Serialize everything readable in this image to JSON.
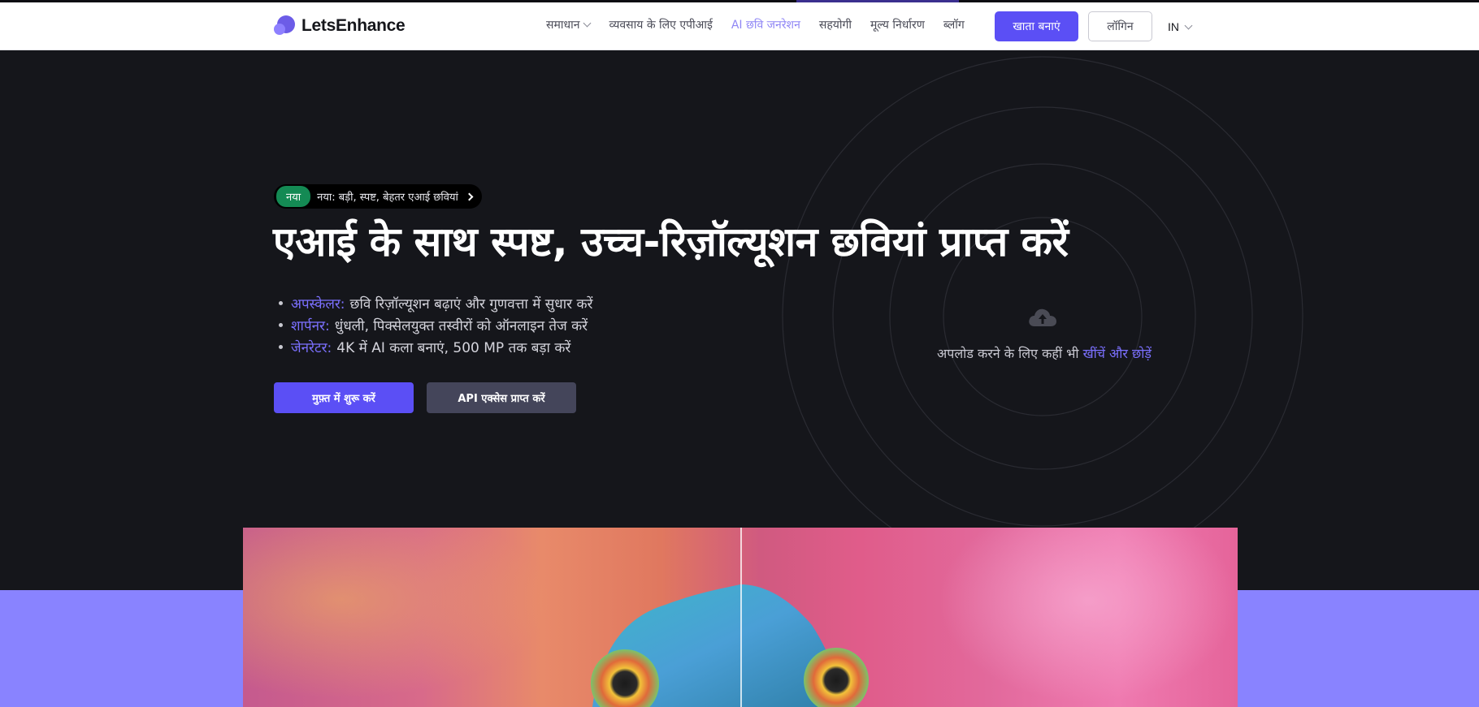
{
  "app": {
    "brand": "LetsEnhance"
  },
  "nav": {
    "items": [
      {
        "label": "समाधान",
        "has_dropdown": true
      },
      {
        "label": "व्यवसाय के लिए एपीआई"
      },
      {
        "label": "AI छवि जनरेशन",
        "active": true
      },
      {
        "label": "सहयोगी"
      },
      {
        "label": "मूल्य निर्धारण"
      },
      {
        "label": "ब्लॉग"
      }
    ],
    "signup_label": "खाता बनाएं",
    "login_label": "लॉगिन",
    "language": "IN"
  },
  "hero": {
    "badge_tag": "नया",
    "badge_text": "नया: बड़ी, स्पष्ट, बेहतर एआई छवियां",
    "headline": "एआई के साथ स्पष्ट, उच्च-रिज़ॉल्यूशन छवियां प्राप्त करें",
    "features": [
      {
        "key": "अपस्केलर:",
        "text": "छवि रिज़ॉल्यूशन बढ़ाएं और गुणवत्ता में सुधार करें"
      },
      {
        "key": "शार्पनर:",
        "text": "धुंधली, पिक्सेलयुक्त तस्वीरों को ऑनलाइन तेज करें"
      },
      {
        "key": "जेनरेटर:",
        "text": "4K में AI कला बनाएं, 500 MP तक बड़ा करें"
      }
    ],
    "primary_cta": "मुफ़्त में शुरू करें",
    "secondary_cta": "API एक्सेस प्राप्त करें"
  },
  "upload": {
    "icon": "cloud-upload-icon",
    "text": "अपलोड करने के लिए कहीं भी",
    "link": "खींचें और छोड़ें"
  },
  "colors": {
    "accent": "#5b4ff5",
    "accent_text": "#7b70ff",
    "hero_bg": "#15161b",
    "band": "#8983ff",
    "badge_green": "#148a54"
  }
}
